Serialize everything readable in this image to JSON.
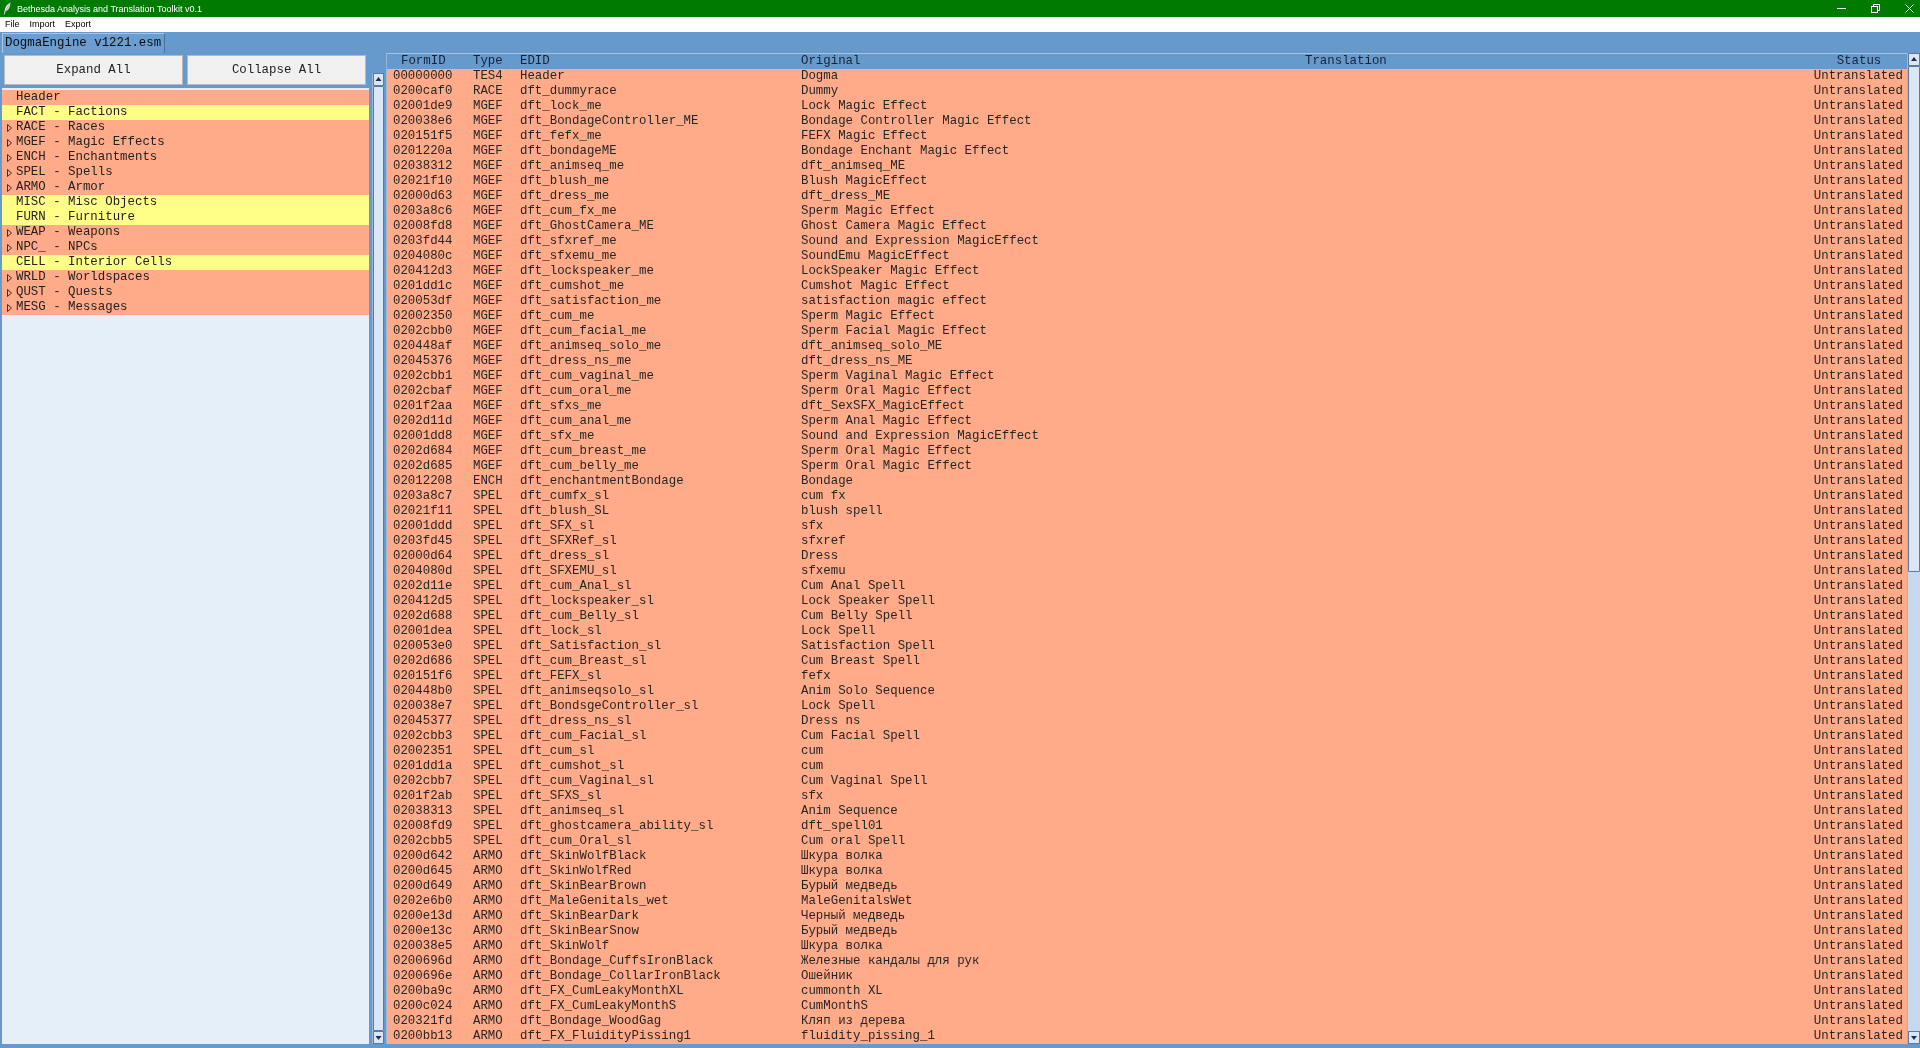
{
  "window": {
    "title": "Bethesda Analysis and Translation Toolkit v0.1"
  },
  "menu": [
    "File",
    "Import",
    "Export"
  ],
  "tabs": [
    {
      "label": "DogmaEngine v1221.esm",
      "selected": true
    }
  ],
  "buttons": [
    "Expand All",
    "Collapse All"
  ],
  "tree": {
    "items": [
      {
        "label": "Header",
        "expandable": false,
        "color": "#ffaa88"
      },
      {
        "label": "FACT - Factions",
        "expandable": false,
        "color": "#ffff88"
      },
      {
        "label": "RACE - Races",
        "expandable": true,
        "color": "#ffaa88"
      },
      {
        "label": "MGEF - Magic Effects",
        "expandable": true,
        "color": "#ffaa88"
      },
      {
        "label": "ENCH - Enchantments",
        "expandable": true,
        "color": "#ffaa88"
      },
      {
        "label": "SPEL - Spells",
        "expandable": true,
        "color": "#ffaa88"
      },
      {
        "label": "ARMO - Armor",
        "expandable": true,
        "color": "#ffaa88"
      },
      {
        "label": "MISC - Misc Objects",
        "expandable": false,
        "color": "#ffff88"
      },
      {
        "label": "FURN - Furniture",
        "expandable": false,
        "color": "#ffff88"
      },
      {
        "label": "WEAP - Weapons",
        "expandable": true,
        "color": "#ffaa88"
      },
      {
        "label": "NPC_ - NPCs",
        "expandable": true,
        "color": "#ffaa88"
      },
      {
        "label": "CELL - Interior Cells",
        "expandable": false,
        "color": "#ffff88"
      },
      {
        "label": "WRLD - Worldspaces",
        "expandable": true,
        "color": "#ffaa88"
      },
      {
        "label": "QUST - Quests",
        "expandable": true,
        "color": "#ffaa88"
      },
      {
        "label": "MESG - Messages",
        "expandable": true,
        "color": "#ffaa88"
      }
    ]
  },
  "table": {
    "columns": [
      "FormID",
      "Type",
      "EDID",
      "Original",
      "Translation",
      "Status"
    ],
    "rows": [
      {
        "form_id": "00000000",
        "type": "TES4",
        "edid": "Header",
        "original": "Dogma",
        "status": "Untranslated"
      },
      {
        "form_id": "0200caf0",
        "type": "RACE",
        "edid": "dft_dummyrace",
        "original": "Dummy",
        "status": "Untranslated"
      },
      {
        "form_id": "02001de9",
        "type": "MGEF",
        "edid": "dft_lock_me",
        "original": "Lock Magic Effect",
        "status": "Untranslated"
      },
      {
        "form_id": "020038e6",
        "type": "MGEF",
        "edid": "dft_BondageController_ME",
        "original": "Bondage Controller Magic Effect",
        "status": "Untranslated"
      },
      {
        "form_id": "020151f5",
        "type": "MGEF",
        "edid": "dft_fefx_me",
        "original": "FEFX Magic Effect",
        "status": "Untranslated"
      },
      {
        "form_id": "0201220a",
        "type": "MGEF",
        "edid": "dft_bondageME",
        "original": "Bondage Enchant Magic Effect",
        "status": "Untranslated"
      },
      {
        "form_id": "02038312",
        "type": "MGEF",
        "edid": "dft_animseq_me",
        "original": "dft_animseq_ME",
        "status": "Untranslated"
      },
      {
        "form_id": "02021f10",
        "type": "MGEF",
        "edid": "dft_blush_me",
        "original": "Blush MagicEffect",
        "status": "Untranslated"
      },
      {
        "form_id": "02000d63",
        "type": "MGEF",
        "edid": "dft_dress_me",
        "original": "dft_dress_ME",
        "status": "Untranslated"
      },
      {
        "form_id": "0203a8c6",
        "type": "MGEF",
        "edid": "dft_cum_fx_me",
        "original": "Sperm Magic Effect",
        "status": "Untranslated"
      },
      {
        "form_id": "02008fd8",
        "type": "MGEF",
        "edid": "dft_GhostCamera_ME",
        "original": "Ghost Camera Magic Effect",
        "status": "Untranslated"
      },
      {
        "form_id": "0203fd44",
        "type": "MGEF",
        "edid": "dft_sfxref_me",
        "original": "Sound and Expression MagicEffect",
        "status": "Untranslated"
      },
      {
        "form_id": "0204080c",
        "type": "MGEF",
        "edid": "dft_sfxemu_me",
        "original": "SoundEmu MagicEffect",
        "status": "Untranslated"
      },
      {
        "form_id": "020412d3",
        "type": "MGEF",
        "edid": "dft_lockspeaker_me",
        "original": "LockSpeaker Magic Effect",
        "status": "Untranslated"
      },
      {
        "form_id": "0201dd1c",
        "type": "MGEF",
        "edid": "dft_cumshot_me",
        "original": "Cumshot Magic Effect",
        "status": "Untranslated"
      },
      {
        "form_id": "020053df",
        "type": "MGEF",
        "edid": "dft_satisfaction_me",
        "original": "satisfaction magic effect",
        "status": "Untranslated"
      },
      {
        "form_id": "02002350",
        "type": "MGEF",
        "edid": "dft_cum_me",
        "original": "Sperm Magic Effect",
        "status": "Untranslated"
      },
      {
        "form_id": "0202cbb0",
        "type": "MGEF",
        "edid": "dft_cum_facial_me",
        "original": "Sperm Facial Magic Effect",
        "status": "Untranslated"
      },
      {
        "form_id": "020448af",
        "type": "MGEF",
        "edid": "dft_animseq_solo_me",
        "original": "dft_animseq_solo_ME",
        "status": "Untranslated"
      },
      {
        "form_id": "02045376",
        "type": "MGEF",
        "edid": "dft_dress_ns_me",
        "original": "dft_dress_ns_ME",
        "status": "Untranslated"
      },
      {
        "form_id": "0202cbb1",
        "type": "MGEF",
        "edid": "dft_cum_vaginal_me",
        "original": "Sperm Vaginal Magic Effect",
        "status": "Untranslated"
      },
      {
        "form_id": "0202cbaf",
        "type": "MGEF",
        "edid": "dft_cum_oral_me",
        "original": "Sperm Oral Magic Effect",
        "status": "Untranslated"
      },
      {
        "form_id": "0201f2aa",
        "type": "MGEF",
        "edid": "dft_sfxs_me",
        "original": "dft_SexSFX_MagicEffect",
        "status": "Untranslated"
      },
      {
        "form_id": "0202d11d",
        "type": "MGEF",
        "edid": "dft_cum_anal_me",
        "original": "Sperm Anal Magic Effect",
        "status": "Untranslated"
      },
      {
        "form_id": "02001dd8",
        "type": "MGEF",
        "edid": "dft_sfx_me",
        "original": "Sound and Expression MagicEffect",
        "status": "Untranslated"
      },
      {
        "form_id": "0202d684",
        "type": "MGEF",
        "edid": "dft_cum_breast_me",
        "original": "Sperm Oral Magic Effect",
        "status": "Untranslated"
      },
      {
        "form_id": "0202d685",
        "type": "MGEF",
        "edid": "dft_cum_belly_me",
        "original": "Sperm Oral Magic Effect",
        "status": "Untranslated"
      },
      {
        "form_id": "02012208",
        "type": "ENCH",
        "edid": "dft_enchantmentBondage",
        "original": "Bondage",
        "status": "Untranslated"
      },
      {
        "form_id": "0203a8c7",
        "type": "SPEL",
        "edid": "dft_cumfx_sl",
        "original": "cum fx",
        "status": "Untranslated"
      },
      {
        "form_id": "02021f11",
        "type": "SPEL",
        "edid": "dft_blush_SL",
        "original": "blush spell",
        "status": "Untranslated"
      },
      {
        "form_id": "02001ddd",
        "type": "SPEL",
        "edid": "dft_SFX_sl",
        "original": "sfx",
        "status": "Untranslated"
      },
      {
        "form_id": "0203fd45",
        "type": "SPEL",
        "edid": "dft_SFXRef_sl",
        "original": "sfxref",
        "status": "Untranslated"
      },
      {
        "form_id": "02000d64",
        "type": "SPEL",
        "edid": "dft_dress_sl",
        "original": "Dress",
        "status": "Untranslated"
      },
      {
        "form_id": "0204080d",
        "type": "SPEL",
        "edid": "dft_SFXEMU_sl",
        "original": "sfxemu",
        "status": "Untranslated"
      },
      {
        "form_id": "0202d11e",
        "type": "SPEL",
        "edid": "dft_cum_Anal_sl",
        "original": "Cum Anal Spell",
        "status": "Untranslated"
      },
      {
        "form_id": "020412d5",
        "type": "SPEL",
        "edid": "dft_lockspeaker_sl",
        "original": "Lock Speaker Spell",
        "status": "Untranslated"
      },
      {
        "form_id": "0202d688",
        "type": "SPEL",
        "edid": "dft_cum_Belly_sl",
        "original": "Cum Belly Spell",
        "status": "Untranslated"
      },
      {
        "form_id": "02001dea",
        "type": "SPEL",
        "edid": "dft_lock_sl",
        "original": "Lock Spell",
        "status": "Untranslated"
      },
      {
        "form_id": "020053e0",
        "type": "SPEL",
        "edid": "dft_Satisfaction_sl",
        "original": "Satisfaction Spell",
        "status": "Untranslated"
      },
      {
        "form_id": "0202d686",
        "type": "SPEL",
        "edid": "dft_cum_Breast_sl",
        "original": "Cum Breast Spell",
        "status": "Untranslated"
      },
      {
        "form_id": "020151f6",
        "type": "SPEL",
        "edid": "dft_FEFX_sl",
        "original": "fefx",
        "status": "Untranslated"
      },
      {
        "form_id": "020448b0",
        "type": "SPEL",
        "edid": "dft_animseqsolo_sl",
        "original": "Anim Solo Sequence",
        "status": "Untranslated"
      },
      {
        "form_id": "020038e7",
        "type": "SPEL",
        "edid": "dft_BondsgeController_sl",
        "original": "Lock Spell",
        "status": "Untranslated"
      },
      {
        "form_id": "02045377",
        "type": "SPEL",
        "edid": "dft_dress_ns_sl",
        "original": "Dress ns",
        "status": "Untranslated"
      },
      {
        "form_id": "0202cbb3",
        "type": "SPEL",
        "edid": "dft_cum_Facial_sl",
        "original": "Cum Facial Spell",
        "status": "Untranslated"
      },
      {
        "form_id": "02002351",
        "type": "SPEL",
        "edid": "dft_cum_sl",
        "original": "cum",
        "status": "Untranslated"
      },
      {
        "form_id": "0201dd1a",
        "type": "SPEL",
        "edid": "dft_cumshot_sl",
        "original": "cum",
        "status": "Untranslated"
      },
      {
        "form_id": "0202cbb7",
        "type": "SPEL",
        "edid": "dft_cum_Vaginal_sl",
        "original": "Cum Vaginal Spell",
        "status": "Untranslated"
      },
      {
        "form_id": "0201f2ab",
        "type": "SPEL",
        "edid": "dft_SFXS_sl",
        "original": "sfx",
        "status": "Untranslated"
      },
      {
        "form_id": "02038313",
        "type": "SPEL",
        "edid": "dft_animseq_sl",
        "original": "Anim Sequence",
        "status": "Untranslated"
      },
      {
        "form_id": "02008fd9",
        "type": "SPEL",
        "edid": "dft_ghostcamera_ability_sl",
        "original": "dft_spell01",
        "status": "Untranslated"
      },
      {
        "form_id": "0202cbb5",
        "type": "SPEL",
        "edid": "dft_cum_Oral_sl",
        "original": "Cum oral Spell",
        "status": "Untranslated"
      },
      {
        "form_id": "0200d642",
        "type": "ARMO",
        "edid": "dft_SkinWolfBlack",
        "original": "Шкура волка",
        "status": "Untranslated"
      },
      {
        "form_id": "0200d645",
        "type": "ARMO",
        "edid": "dft_SkinWolfRed",
        "original": "Шкура волка",
        "status": "Untranslated"
      },
      {
        "form_id": "0200d649",
        "type": "ARMO",
        "edid": "dft_SkinBearBrown",
        "original": "Бурый медведь",
        "status": "Untranslated"
      },
      {
        "form_id": "0202e6b0",
        "type": "ARMO",
        "edid": "dft_MaleGenitals_wet",
        "original": "MaleGenitalsWet",
        "status": "Untranslated"
      },
      {
        "form_id": "0200e13d",
        "type": "ARMO",
        "edid": "dft_SkinBearDark",
        "original": "Черный медведь",
        "status": "Untranslated"
      },
      {
        "form_id": "0200e13c",
        "type": "ARMO",
        "edid": "dft_SkinBearSnow",
        "original": "Бурый медведь",
        "status": "Untranslated"
      },
      {
        "form_id": "020038e5",
        "type": "ARMO",
        "edid": "dft_SkinWolf",
        "original": "Шкура волка",
        "status": "Untranslated"
      },
      {
        "form_id": "0200696d",
        "type": "ARMO",
        "edid": "dft_Bondage_CuffsIronBlack",
        "original": "Железные кандалы для рук",
        "status": "Untranslated"
      },
      {
        "form_id": "0200696e",
        "type": "ARMO",
        "edid": "dft_Bondage_CollarIronBlack",
        "original": "Ошейник",
        "status": "Untranslated"
      },
      {
        "form_id": "0200ba9c",
        "type": "ARMO",
        "edid": "dft_FX_CumLeakyMonthXL",
        "original": "cummonth XL",
        "status": "Untranslated"
      },
      {
        "form_id": "0200c024",
        "type": "ARMO",
        "edid": "dft_FX_CumLeakyMonthS",
        "original": "CumMonthS",
        "status": "Untranslated"
      },
      {
        "form_id": "020321fd",
        "type": "ARMO",
        "edid": "dft_Bondage_WoodGag",
        "original": "Кляп из дерева",
        "status": "Untranslated"
      },
      {
        "form_id": "0200bb13",
        "type": "ARMO",
        "edid": "dft_FX_FluidityPissing1",
        "original": "fluidity_pissing_1",
        "status": "Untranslated"
      }
    ]
  }
}
